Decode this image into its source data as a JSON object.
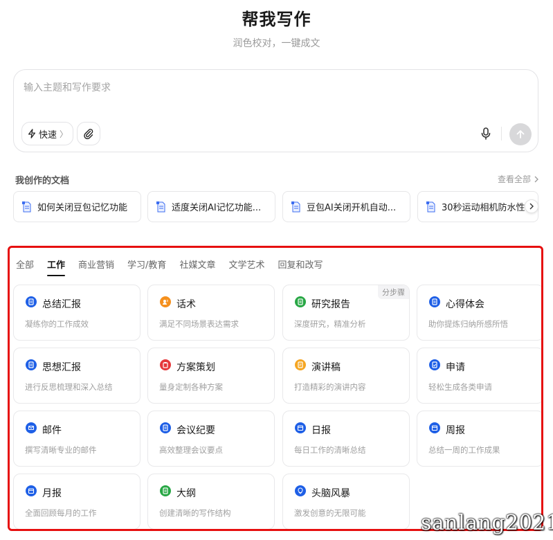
{
  "header": {
    "title": "帮我写作",
    "subtitle": "润色校对，一键成文"
  },
  "composer": {
    "placeholder": "输入主题和写作要求",
    "value": "",
    "mode_label": "快速",
    "mode_chevron": "〉",
    "attach_icon": "paperclip-icon",
    "mic_icon": "microphone-icon",
    "send_icon": "arrow-up-icon"
  },
  "docs": {
    "header": "我创作的文档",
    "view_all": "查看全部",
    "items": [
      {
        "title": "如何关闭豆包记忆功能"
      },
      {
        "title": "适度关闭AI记忆功能..."
      },
      {
        "title": "豆包AI关闭开机自动..."
      },
      {
        "title": "30秒运动相机防水性"
      }
    ]
  },
  "categories": {
    "tabs": [
      "全部",
      "工作",
      "商业营销",
      "学习/教育",
      "社媒文章",
      "文学艺术",
      "回复和改写"
    ],
    "active_tab": "工作"
  },
  "templates": [
    {
      "title": "总结汇报",
      "desc": "凝练你的工作成效",
      "color": "#1e5fe6",
      "icon": "document-icon"
    },
    {
      "title": "话术",
      "desc": "满足不同场景表达需求",
      "color": "#f5901e",
      "icon": "person-speech-icon"
    },
    {
      "title": "研究报告",
      "desc": "深度研究，精准分析",
      "color": "#28a745",
      "icon": "report-icon",
      "badge": "分步骤"
    },
    {
      "title": "心得体会",
      "desc": "助你提炼归纳所感所悟",
      "color": "#1e5fe6",
      "icon": "document-icon"
    },
    {
      "title": "思想汇报",
      "desc": "进行反思梳理和深入总结",
      "color": "#1e5fe6",
      "icon": "document-icon"
    },
    {
      "title": "方案策划",
      "desc": "量身定制各种方案",
      "color": "#e5383b",
      "icon": "plan-icon"
    },
    {
      "title": "演讲稿",
      "desc": "打造精彩的演讲内容",
      "color": "#f5a623",
      "icon": "speech-icon"
    },
    {
      "title": "申请",
      "desc": "轻松生成各类申请",
      "color": "#1e5fe6",
      "icon": "application-icon"
    },
    {
      "title": "邮件",
      "desc": "撰写清晰专业的邮件",
      "color": "#1e5fe6",
      "icon": "mail-icon"
    },
    {
      "title": "会议纪要",
      "desc": "高效整理会议要点",
      "color": "#1e5fe6",
      "icon": "document-icon"
    },
    {
      "title": "日报",
      "desc": "每日工作的清晰总结",
      "color": "#1e5fe6",
      "icon": "calendar-icon"
    },
    {
      "title": "周报",
      "desc": "总结一周的工作成果",
      "color": "#1e5fe6",
      "icon": "calendar-icon"
    },
    {
      "title": "月报",
      "desc": "全面回顾每月的工作",
      "color": "#1e5fe6",
      "icon": "calendar-icon"
    },
    {
      "title": "大纲",
      "desc": "创建清晰的写作结构",
      "color": "#28a745",
      "icon": "outline-icon"
    },
    {
      "title": "头脑风暴",
      "desc": "激发创意的无限可能",
      "color": "#1e5fe6",
      "icon": "lightbulb-icon"
    }
  ],
  "watermark": "sanlang2021"
}
